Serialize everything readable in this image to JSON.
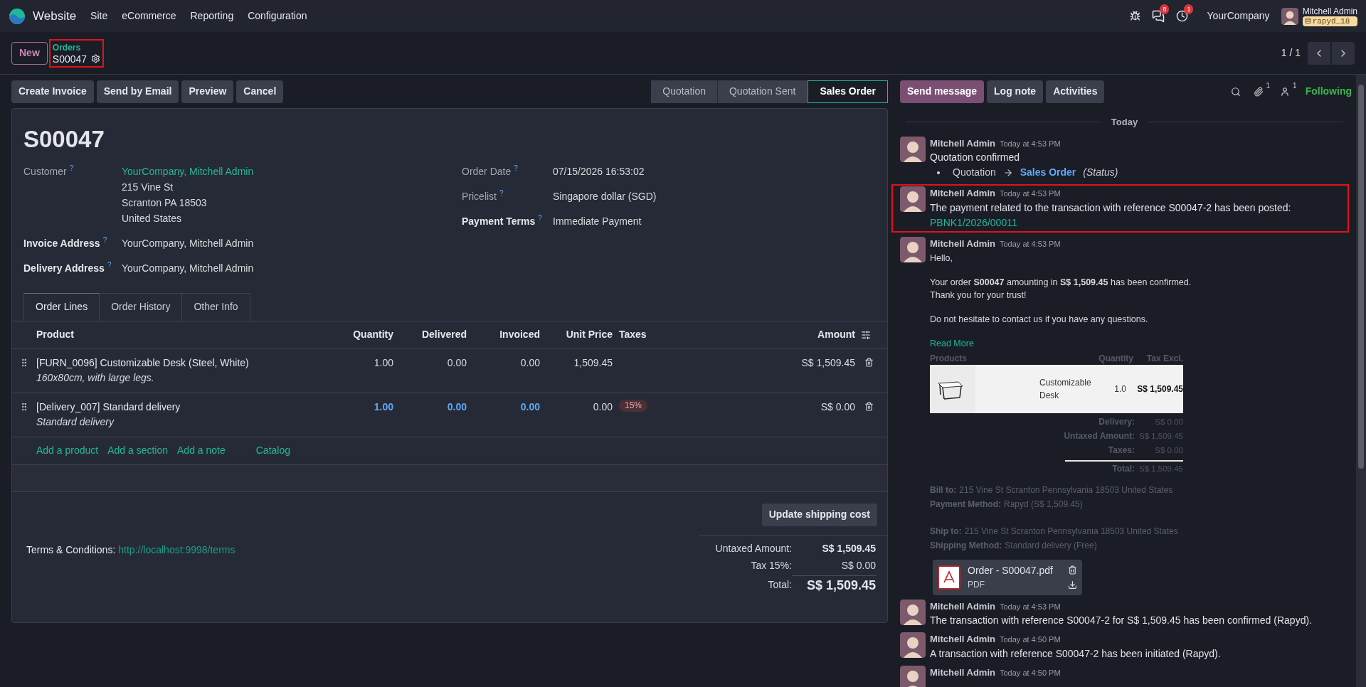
{
  "navbar": {
    "app": "Website",
    "menu": [
      "Site",
      "eCommerce",
      "Reporting",
      "Configuration"
    ],
    "messages_badge": "8",
    "activities_badge": "1",
    "company": "YourCompany",
    "user": "Mitchell Admin",
    "database": "rapyd_18"
  },
  "control_panel": {
    "new_button": "New",
    "breadcrumb": {
      "parent": "Orders",
      "current": "S00047",
      "highlighted": true
    },
    "pager": "1 / 1"
  },
  "action_buttons": [
    "Create Invoice",
    "Send by Email",
    "Preview",
    "Cancel"
  ],
  "status_steps": [
    {
      "label": "Quotation",
      "selected": false
    },
    {
      "label": "Quotation Sent",
      "selected": false
    },
    {
      "label": "Sales Order",
      "selected": true
    }
  ],
  "form": {
    "title": "S00047",
    "left_fields": [
      {
        "label": "Customer",
        "help": "?",
        "emphasized": false,
        "values": [
          {
            "text": "YourCompany, Mitchell Admin",
            "link": true
          },
          {
            "text": "215 Vine St",
            "link": false
          },
          {
            "text": "Scranton PA 18503",
            "link": false
          },
          {
            "text": "United States",
            "link": false
          }
        ]
      },
      {
        "label": "Invoice Address",
        "help": "?",
        "emphasized": true,
        "values": [
          {
            "text": "YourCompany, Mitchell Admin",
            "link": false
          }
        ]
      },
      {
        "label": "Delivery Address",
        "help": "?",
        "emphasized": true,
        "values": [
          {
            "text": "YourCompany, Mitchell Admin",
            "link": false
          }
        ]
      }
    ],
    "right_fields": [
      {
        "label": "Order Date",
        "help": "?",
        "emphasized": false,
        "values": [
          {
            "text": "07/15/2026 16:53:02",
            "link": false
          }
        ]
      },
      {
        "label": "Pricelist",
        "help": "?",
        "emphasized": false,
        "values": [
          {
            "text": "Singapore dollar (SGD)",
            "link": false
          }
        ]
      },
      {
        "label": "Payment Terms",
        "help": "?",
        "emphasized": true,
        "values": [
          {
            "text": "Immediate Payment",
            "link": false
          }
        ]
      }
    ],
    "tabs": [
      {
        "label": "Order Lines",
        "selected": true
      },
      {
        "label": "Order History",
        "selected": false
      },
      {
        "label": "Other Info",
        "selected": false
      }
    ],
    "columns": [
      "Product",
      "Quantity",
      "Delivered",
      "Invoiced",
      "Unit Price",
      "Taxes",
      "Amount"
    ],
    "lines": [
      {
        "product": "[FURN_0096] Customizable Desk (Steel, White)",
        "description": "160x80cm, with large legs.",
        "quantity": "1.00",
        "delivered": "0.00",
        "invoiced": "0.00",
        "unit_price": "1,509.45",
        "amount": "S$ 1,509.45",
        "readonly": false
      },
      {
        "product": "[Delivery_007] Standard delivery",
        "description": "Standard delivery",
        "quantity": "1.00",
        "delivered": "0.00",
        "invoiced": "0.00",
        "unit_price": "0.00",
        "taxes": [
          "15%"
        ],
        "amount": "S$ 0.00",
        "readonly": true
      }
    ],
    "line_actions": [
      "Add a product",
      "Add a section",
      "Add a note",
      "Catalog"
    ],
    "update_button": "Update shipping cost",
    "terms": {
      "label": "Terms & Conditions:",
      "link": "http://localhost:9998/terms"
    },
    "totals": [
      {
        "label": "Untaxed Amount:",
        "value": "S$ 1,509.45",
        "kind": "subtotal"
      },
      {
        "label": "Tax 15%:",
        "value": "S$ 0.00",
        "kind": "tax"
      },
      {
        "label": "Total:",
        "value": "S$ 1,509.45",
        "kind": "total"
      }
    ]
  },
  "chatter": {
    "buttons": [
      {
        "label": "Send message",
        "primary": true
      },
      {
        "label": "Log note",
        "primary": false
      },
      {
        "label": "Activities",
        "primary": false
      }
    ],
    "attachments_count": "1",
    "followers_count": "1",
    "follow_label": "Following",
    "date_separator": "Today",
    "messages": [
      {
        "kind": "tracking",
        "author": "Mitchell Admin",
        "time": "Today at 4:53 PM",
        "highlighted": false,
        "body": "Quotation confirmed",
        "old_value": "Quotation",
        "new_value": "Sales Order",
        "field": "(Status)"
      },
      {
        "kind": "text",
        "author": "Mitchell Admin",
        "time": "Today at 4:53 PM",
        "highlighted": true,
        "body": "The payment related to the transaction with reference S00047-2 has been posted:",
        "link": "PBNK1/2026/00011"
      },
      {
        "kind": "email",
        "author": "Mitchell Admin",
        "time": "Today at 4:53 PM",
        "highlighted": false,
        "paragraphs": [
          [
            "Hello,"
          ],
          [
            "Your order **S00047** amounting in **S$ 1,509.45** has been confirmed.",
            "Thank you for your trust!"
          ],
          [
            "Do not hesitate to contact us if you have any questions."
          ]
        ],
        "read_more": "Read More",
        "table_headers": [
          "Products",
          "Quantity",
          "Tax Excl."
        ],
        "product": {
          "name": "Customizable Desk",
          "quantity": "1.0",
          "amount": "S$ 1,509.45"
        },
        "summary": [
          {
            "label": "Delivery:",
            "value": "S$ 0.00"
          },
          {
            "label": "Untaxed Amount:",
            "value": "S$ 1,509.45"
          },
          {
            "label": "Taxes:",
            "value": "S$ 0.00"
          },
          {
            "label": "Total:",
            "value": "S$ 1,509.45"
          }
        ],
        "addresses": [
          [
            {
              "label": "Bill to:",
              "value": "215 Vine St Scranton Pennsylvania 18503 United States"
            },
            {
              "label": "Payment Method:",
              "value": "Rapyd (S$ 1,509.45)"
            }
          ],
          [
            {
              "label": "Ship to:",
              "value": "215 Vine St Scranton Pennsylvania 18503 United States"
            },
            {
              "label": "Shipping Method:",
              "value": "Standard delivery (Free)"
            }
          ]
        ],
        "attachment": {
          "name": "Order - S00047.pdf",
          "type": "PDF"
        }
      },
      {
        "kind": "text",
        "author": "Mitchell Admin",
        "time": "Today at 4:53 PM",
        "highlighted": false,
        "body": "The transaction with reference S00047-2 for S$ 1,509.45 has been confirmed (Rapyd)."
      },
      {
        "kind": "text",
        "author": "Mitchell Admin",
        "time": "Today at 4:50 PM",
        "highlighted": false,
        "body": "A transaction with reference S00047-2 has been initiated (Rapyd)."
      },
      {
        "kind": "header",
        "author": "Mitchell Admin",
        "time": "Today at 4:50 PM",
        "highlighted": false
      }
    ]
  }
}
